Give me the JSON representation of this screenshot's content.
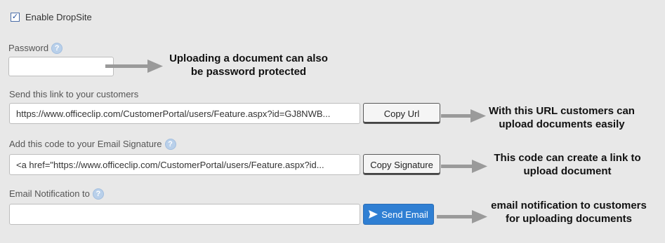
{
  "dropsite": {
    "enable_label": "Enable DropSite",
    "enabled": true
  },
  "password": {
    "label": "Password",
    "value": ""
  },
  "link": {
    "label": "Send this link to your customers",
    "value": "https://www.officeclip.com/CustomerPortal/users/Feature.aspx?id=GJ8NWB...",
    "button": "Copy Url"
  },
  "signature": {
    "label": "Add this code to your Email Signature",
    "value": "<a href=\"https://www.officeclip.com/CustomerPortal/users/Feature.aspx?id...",
    "button": "Copy Signature"
  },
  "email": {
    "label": "Email Notification to",
    "value": "",
    "button": "Send Email"
  },
  "annotations": {
    "password_line1": "Uploading a document can also",
    "password_line2": "be password protected",
    "link_line1": "With this URL customers can",
    "link_line2": "upload documents easily",
    "signature_line1": "This code can create a link to",
    "signature_line2": "upload document",
    "email_line1": "email notification to customers",
    "email_line2": "for uploading documents"
  },
  "icons": {
    "help": "help-icon",
    "send": "send-icon",
    "arrow": "arrow-right-icon"
  }
}
